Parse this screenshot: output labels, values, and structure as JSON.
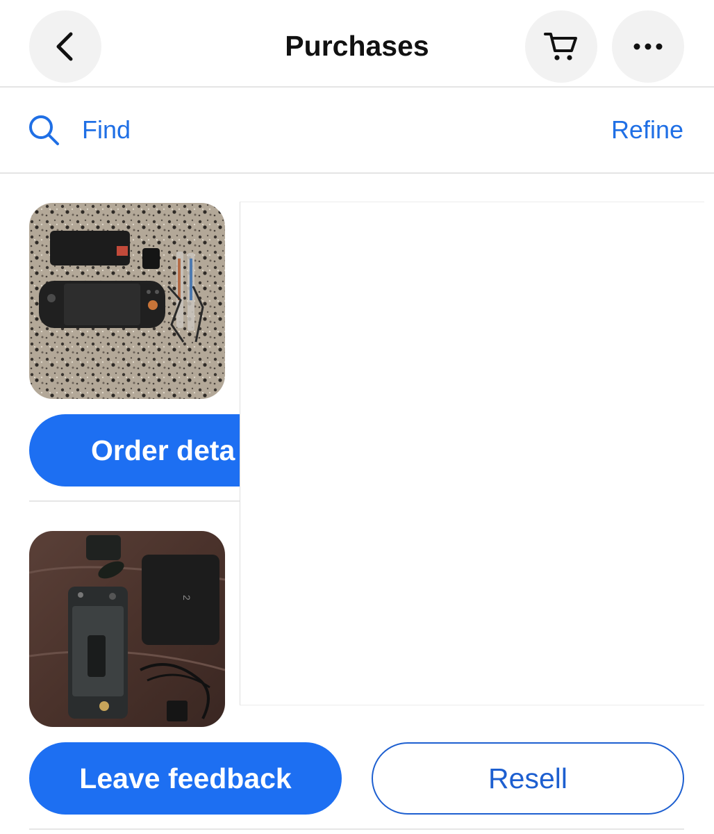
{
  "header": {
    "title": "Purchases",
    "back_icon": "chevron-left-icon",
    "cart_icon": "cart-icon",
    "more_icon": "more-horizontal-icon"
  },
  "search": {
    "find_label": "Find",
    "refine_label": "Refine",
    "search_icon": "search-icon"
  },
  "orders": [
    {
      "action_label": "Order deta"
    },
    {
      "primary_action_label": "Leave feedback",
      "secondary_action_label": "Resell"
    }
  ],
  "colors": {
    "accent": "#1d6ff2",
    "link": "#1f6fe5",
    "button_bg": "#f2f2f2"
  }
}
